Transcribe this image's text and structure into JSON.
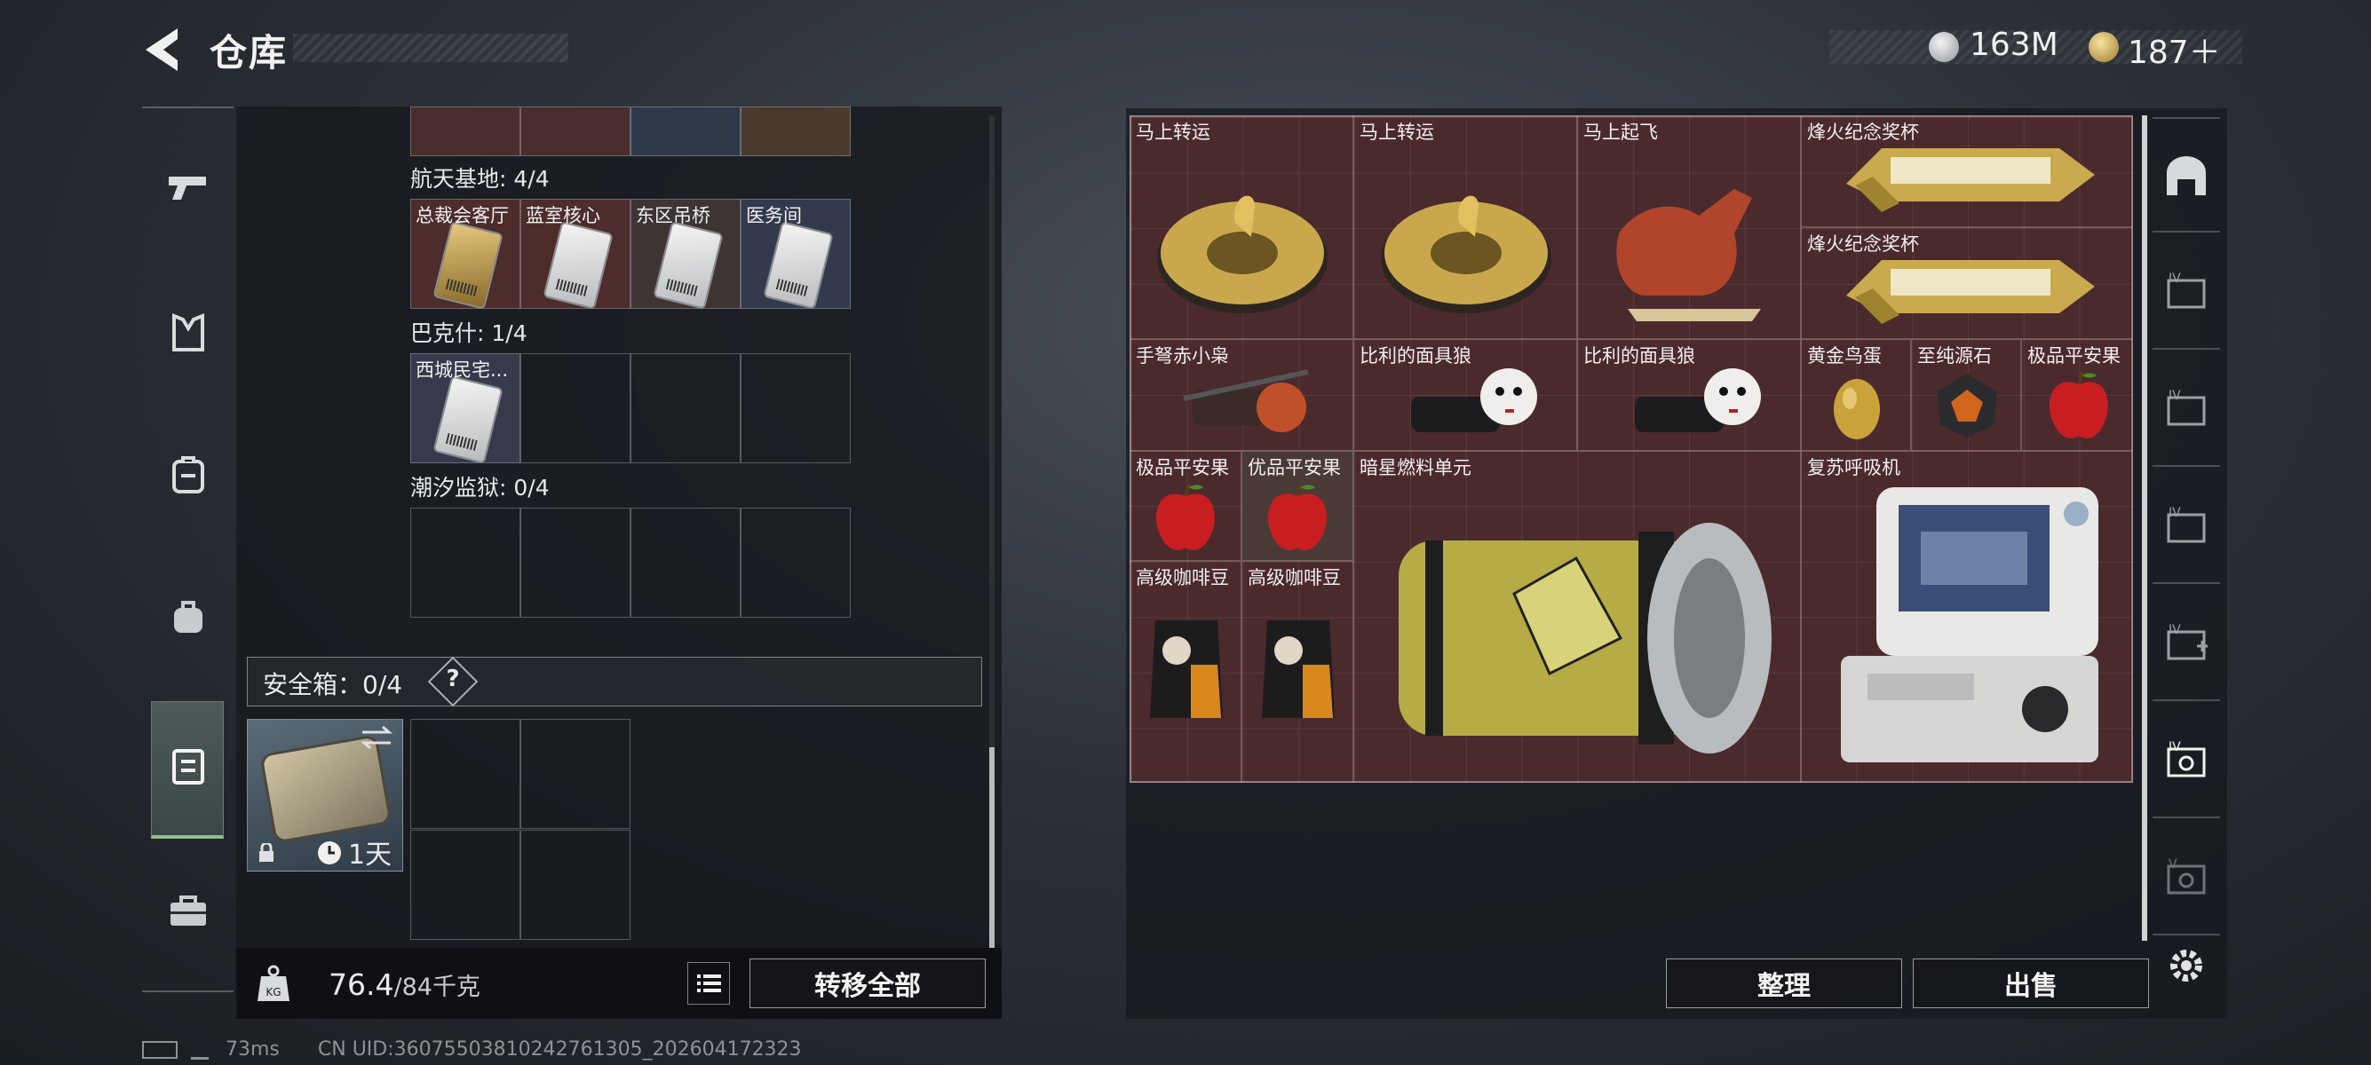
{
  "header": {
    "title": "仓库",
    "currency_1": "163M",
    "currency_2": "187＋"
  },
  "left": {
    "sections": [
      {
        "label": "航天基地: 4/4",
        "cells": [
          "总裁会客厅",
          "蓝室核心",
          "东区吊桥",
          "医务间"
        ]
      },
      {
        "label": "巴克什: 1/4",
        "cells": [
          "西城民宅...",
          "",
          "",
          ""
        ]
      },
      {
        "label": "潮汐监狱: 0/4",
        "cells": [
          "",
          "",
          "",
          ""
        ]
      }
    ],
    "safe_box_label": "安全箱：0/4",
    "help": "?",
    "case_timer": "1天",
    "weight": "76.4",
    "weight_max": "/84千克",
    "transfer_all": "转移全部"
  },
  "stash": {
    "items": [
      {
        "label": "马上转运"
      },
      {
        "label": "马上转运"
      },
      {
        "label": "马上起飞"
      },
      {
        "label": "烽火纪念奖杯"
      },
      {
        "label": "烽火纪念奖杯"
      },
      {
        "label": "手弩赤小枭"
      },
      {
        "label": "比利的面具狼"
      },
      {
        "label": "比利的面具狼"
      },
      {
        "label": "黄金鸟蛋"
      },
      {
        "label": "至纯源石"
      },
      {
        "label": "极品平安果"
      },
      {
        "label": "极品平安果"
      },
      {
        "label": "优品平安果"
      },
      {
        "label": "暗星燃料单元"
      },
      {
        "label": "复苏呼吸机"
      },
      {
        "label": "高级咖啡豆"
      },
      {
        "label": "高级咖啡豆"
      }
    ],
    "sort_button": "整理",
    "sell_button": "出售"
  },
  "status": {
    "ping": "73ms",
    "uid": "CN UID:36075503810242761305_202604172323"
  },
  "colors": {
    "stash_bg": "#4a2a2d",
    "selected_tab_accent": "#8fbf8c"
  }
}
